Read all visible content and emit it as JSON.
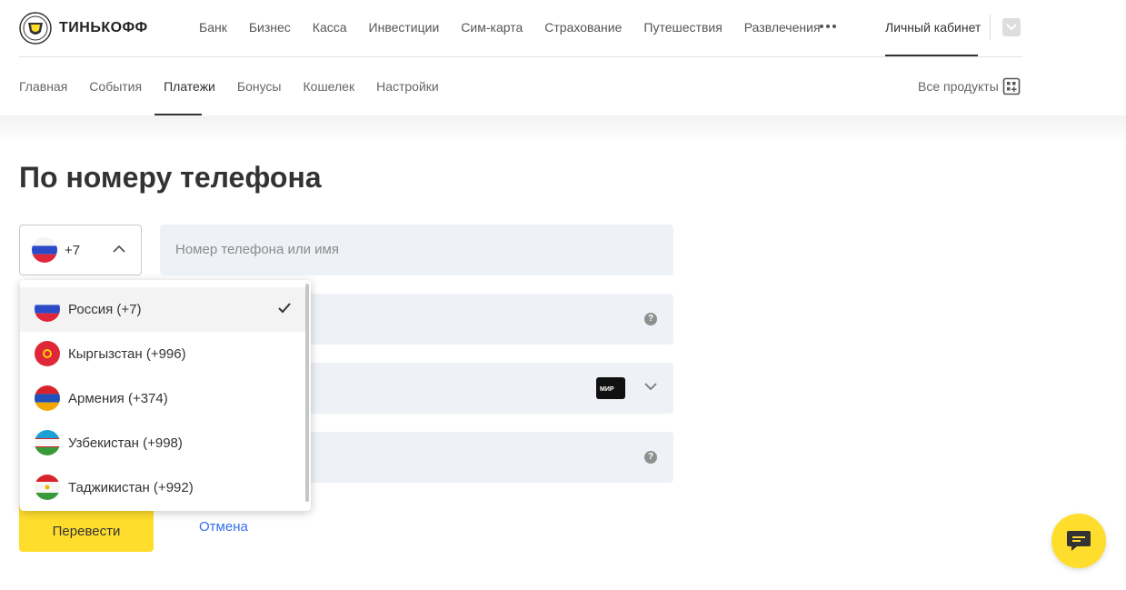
{
  "brand": {
    "name": "ТИНЬКОФФ"
  },
  "top_nav": [
    "Банк",
    "Бизнес",
    "Касса",
    "Инвестиции",
    "Сим-карта",
    "Страхование",
    "Путешествия",
    "Развлечения"
  ],
  "cabinet_label": "Личный кабинет",
  "sub_nav": [
    "Главная",
    "События",
    "Платежи",
    "Бонусы",
    "Кошелек",
    "Настройки"
  ],
  "sub_nav_active": "Платежи",
  "all_products": "Все продукты",
  "page_title": "По номеру телефона",
  "country_select": {
    "code": "+7"
  },
  "phone_field": {
    "placeholder": "Номер телефона или имя"
  },
  "card_badge": "МИР",
  "dropdown": [
    {
      "label": "Россия (+7)",
      "selected": true,
      "flag": "russia-flag"
    },
    {
      "label": "Кыргызстан (+996)",
      "selected": false,
      "flag": "kyrgyzstan-flag"
    },
    {
      "label": "Армения (+374)",
      "selected": false,
      "flag": "armenia-flag"
    },
    {
      "label": "Узбекистан (+998)",
      "selected": false,
      "flag": "uzbekistan-flag"
    },
    {
      "label": "Таджикистан (+992)",
      "selected": false,
      "flag": "tajikistan-flag"
    }
  ],
  "buttons": {
    "transfer": "Перевести",
    "cancel": "Отмена"
  },
  "colors": {
    "accent": "#ffdd2d",
    "link": "#336fee",
    "field_bg": "#eef2f7"
  }
}
